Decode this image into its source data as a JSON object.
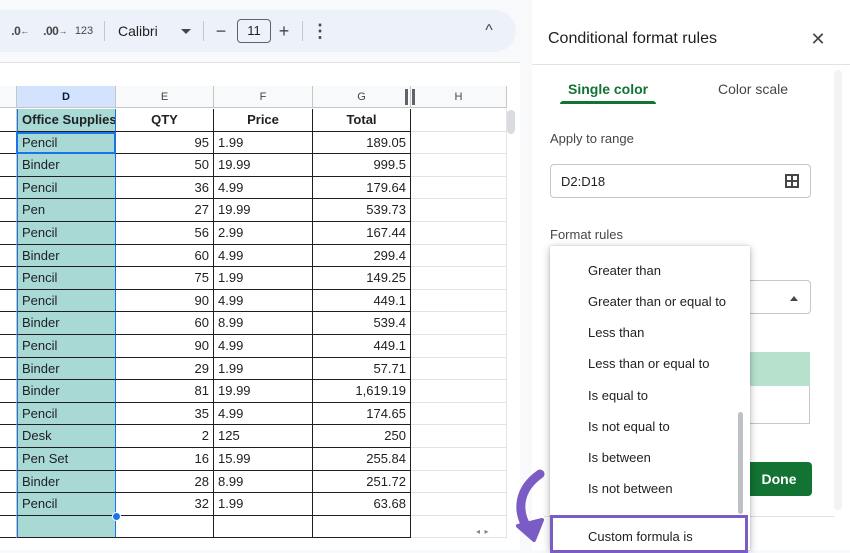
{
  "toolbar": {
    "decrease_decimal": ".0",
    "decrease_decimal_arrow": "←",
    "increase_decimal": ".00",
    "increase_decimal_arrow": "→",
    "number_format": "123",
    "font": "Calibri",
    "font_size": "11",
    "minus": "−",
    "plus": "+",
    "more": "⋮",
    "collapse": "^"
  },
  "sheet": {
    "columns": [
      "D",
      "E",
      "F",
      "G",
      "H"
    ],
    "headers": [
      "Office Supplies",
      "QTY",
      "Price",
      "Total"
    ],
    "rows": [
      [
        "Pencil",
        "95",
        "1.99",
        "189.05"
      ],
      [
        "Binder",
        "50",
        "19.99",
        "999.5"
      ],
      [
        "Pencil",
        "36",
        "4.99",
        "179.64"
      ],
      [
        "Pen",
        "27",
        "19.99",
        "539.73"
      ],
      [
        "Pencil",
        "56",
        "2.99",
        "167.44"
      ],
      [
        "Binder",
        "60",
        "4.99",
        "299.4"
      ],
      [
        "Pencil",
        "75",
        "1.99",
        "149.25"
      ],
      [
        "Pencil",
        "90",
        "4.99",
        "449.1"
      ],
      [
        "Binder",
        "60",
        "8.99",
        "539.4"
      ],
      [
        "Pencil",
        "90",
        "4.99",
        "449.1"
      ],
      [
        "Binder",
        "29",
        "1.99",
        "57.71"
      ],
      [
        "Binder",
        "81",
        "19.99",
        "1,619.19"
      ],
      [
        "Pencil",
        "35",
        "4.99",
        "174.65"
      ],
      [
        "Desk",
        "2",
        "125",
        "250"
      ],
      [
        "Pen Set",
        "16",
        "15.99",
        "255.84"
      ],
      [
        "Binder",
        "28",
        "8.99",
        "251.72"
      ],
      [
        "Pencil",
        "32",
        "1.99",
        "63.68"
      ]
    ],
    "selection_fill": "#a8d9d5"
  },
  "panel": {
    "title": "Conditional format rules",
    "close": "✕",
    "tabs": [
      "Single color",
      "Color scale"
    ],
    "apply_label": "Apply to range",
    "range_value": "D2:D18",
    "format_rules_label": "Format rules",
    "done": "Done",
    "accent": "#137333"
  },
  "dropdown": {
    "items": [
      "Greater than",
      "Greater than or equal to",
      "Less than",
      "Less than or equal to",
      "Is equal to",
      "Is not equal to",
      "Is between",
      "Is not between"
    ],
    "highlighted": "Custom formula is",
    "highlight_color": "#7b5cc4"
  }
}
